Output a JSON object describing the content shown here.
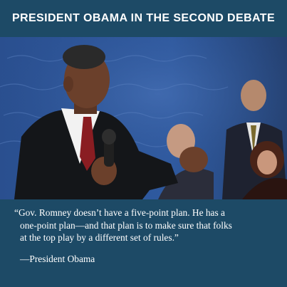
{
  "header": {
    "title": "PRESIDENT OBAMA IN THE SECOND DEBATE"
  },
  "quote": {
    "lines": [
      "“Gov. Romney doesn’t have a five-point plan. He has a",
      "one-point plan—and that plan is to make sure that folks",
      "at the top play by a different set of rules.”"
    ],
    "attribution": "—President Obama"
  },
  "colors": {
    "background": "#1d4a66",
    "text": "#ffffff",
    "photo_backdrop": "#2c4f8e"
  }
}
